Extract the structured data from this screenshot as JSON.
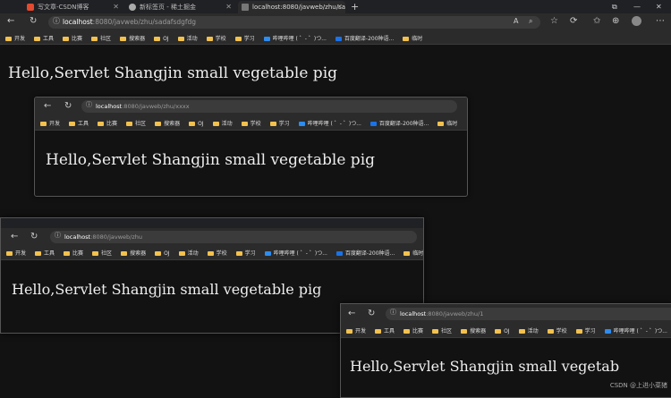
{
  "browser": {
    "tabs": [
      {
        "label": "写文章-CSDN博客",
        "fav_color": "#e34a2f"
      },
      {
        "label": "新标签页 - 稀土掘金",
        "fav_color": "#aaaaaa"
      },
      {
        "label": "localhost:8080/javweb/zhu/sadi",
        "fav_color": "#777777"
      }
    ],
    "new_tab": "+",
    "url": {
      "host": "localhost",
      "path": ":8080/javweb/zhu/sadafsdgfdg"
    }
  },
  "bookmarks": [
    {
      "label": "开发",
      "kind": "folder"
    },
    {
      "label": "工具",
      "kind": "folder"
    },
    {
      "label": "比赛",
      "kind": "folder"
    },
    {
      "label": "社区",
      "kind": "folder"
    },
    {
      "label": "搜索器",
      "kind": "folder"
    },
    {
      "label": "OJ",
      "kind": "folder"
    },
    {
      "label": "活动",
      "kind": "folder"
    },
    {
      "label": "学校",
      "kind": "folder"
    },
    {
      "label": "学习",
      "kind": "folder"
    },
    {
      "label": "哔哩哔哩 ( ゜- ゜)つ...",
      "kind": "site"
    },
    {
      "label": "百度翻译-200种语...",
      "kind": "site"
    },
    {
      "label": "临时",
      "kind": "folder"
    }
  ],
  "main": {
    "text": "Hello,Servlet Shangjin small vegetable pig"
  },
  "shot1": {
    "url": {
      "host": "localhost",
      "path": ":8080/javweb/zhu/xxxx"
    },
    "text": "Hello,Servlet Shangjin small vegetable pig"
  },
  "shot2": {
    "url": {
      "host": "localhost",
      "path": ":8080/javweb/zhu"
    },
    "text": "Hello,Servlet Shangjin small vegetable pig"
  },
  "shot3": {
    "url": {
      "host": "localhost",
      "path": ":8080/javweb/zhu/1"
    },
    "text": "Hello,Servlet Shangjin small vegetab"
  },
  "watermark": "CSDN @上进小菜猪"
}
